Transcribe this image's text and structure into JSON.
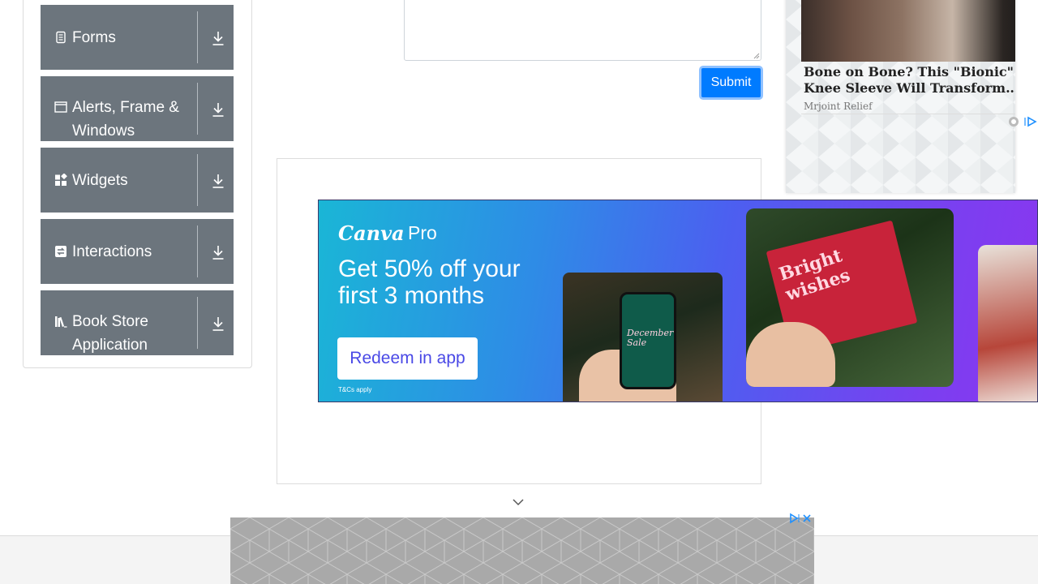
{
  "sidebar": {
    "groups": [
      {
        "label": "Forms",
        "icon": "form-icon"
      },
      {
        "label": "Alerts, Frame & Windows",
        "icon": "window-icon"
      },
      {
        "label": "Widgets",
        "icon": "widgets-icon"
      },
      {
        "label": "Interactions",
        "icon": "interactions-icon"
      },
      {
        "label": "Book Store Application",
        "icon": "books-icon"
      }
    ]
  },
  "form": {
    "submit_label": "Submit"
  },
  "ad_banner": {
    "brand": "Canva",
    "brand_suffix": "Pro",
    "headline": "Get 50% off your first 3 months",
    "cta": "Redeem in app",
    "fine_print": "T&Cs apply",
    "card_text": "Bright wishes",
    "phone_text": "December Sale"
  },
  "side_ad": {
    "headline": "Bone on Bone? This \"Bionic\" Knee Sleeve Will Transform…",
    "sponsor": "Mrjoint Relief"
  },
  "colors": {
    "group_bg": "#6c757d",
    "submit_bg": "#007bff",
    "cta_text": "#4a49e6"
  }
}
